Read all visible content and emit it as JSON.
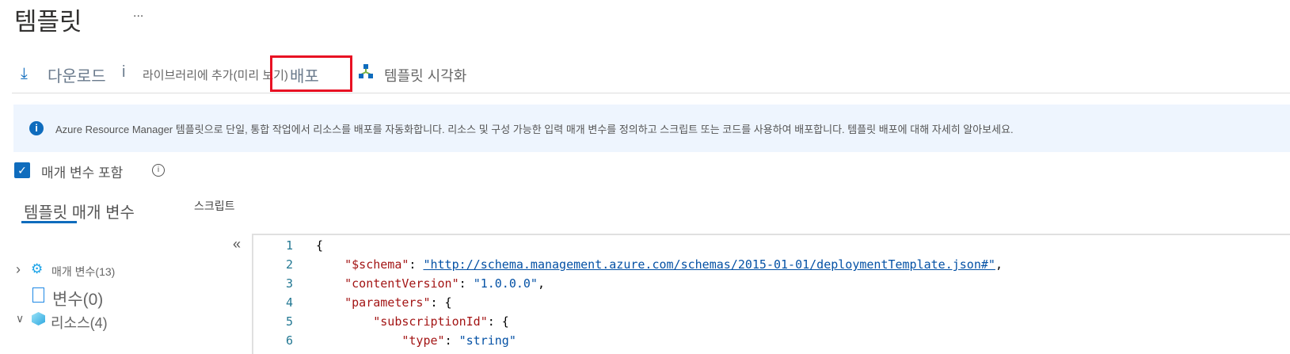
{
  "page": {
    "title": "템플릿",
    "more": "..."
  },
  "toolbar": {
    "download": "다운로드",
    "info_glyph": "i",
    "add_library": "라이브러리에 추가(미리 보기)",
    "deploy": "배포",
    "visualize": "템플릿 시각화"
  },
  "info": {
    "text": "Azure Resource Manager 템플릿으로 단일, 통합 작업에서 리소스를 배포를 자동화합니다. 리소스 및 구성 가능한 입력 매개 변수를 정의하고 스크립트 또는 코드를 사용하여 배포합니다. 템플릿 배포에 대해 자세히 알아보세요."
  },
  "include_params": {
    "label": "매개 변수 포함",
    "checked": true
  },
  "tabs": [
    {
      "label": "템플릿 매개 변수",
      "active": true
    },
    {
      "label": "스크립트",
      "active": false
    }
  ],
  "tree": {
    "collapse": "«",
    "items": [
      {
        "label": "매개 변수(13)",
        "icon": "gear-icon",
        "expanded": false
      },
      {
        "label": "변수(0)",
        "icon": "document-icon"
      },
      {
        "label": "리소스(4)",
        "icon": "cube-icon",
        "expanded": true
      }
    ]
  },
  "editor": {
    "lines": [
      {
        "n": "1",
        "indent": "",
        "key": "",
        "sep": "{",
        "val": "",
        "tail": ""
      },
      {
        "n": "2",
        "indent": "    ",
        "key": "\"$schema\"",
        "sep": ": ",
        "val": "\"http://schema.management.azure.com/schemas/2015-01-01/deploymentTemplate.json#\"",
        "tail": ","
      },
      {
        "n": "3",
        "indent": "    ",
        "key": "\"contentVersion\"",
        "sep": ": ",
        "val": "\"1.0.0.0\"",
        "tail": ","
      },
      {
        "n": "4",
        "indent": "    ",
        "key": "\"parameters\"",
        "sep": ": {",
        "val": "",
        "tail": ""
      },
      {
        "n": "5",
        "indent": "        ",
        "key": "\"subscriptionId\"",
        "sep": ": {",
        "val": "",
        "tail": ""
      },
      {
        "n": "6",
        "indent": "            ",
        "key": "\"type\"",
        "sep": ": ",
        "val": "\"string\"",
        "tail": ""
      }
    ]
  }
}
